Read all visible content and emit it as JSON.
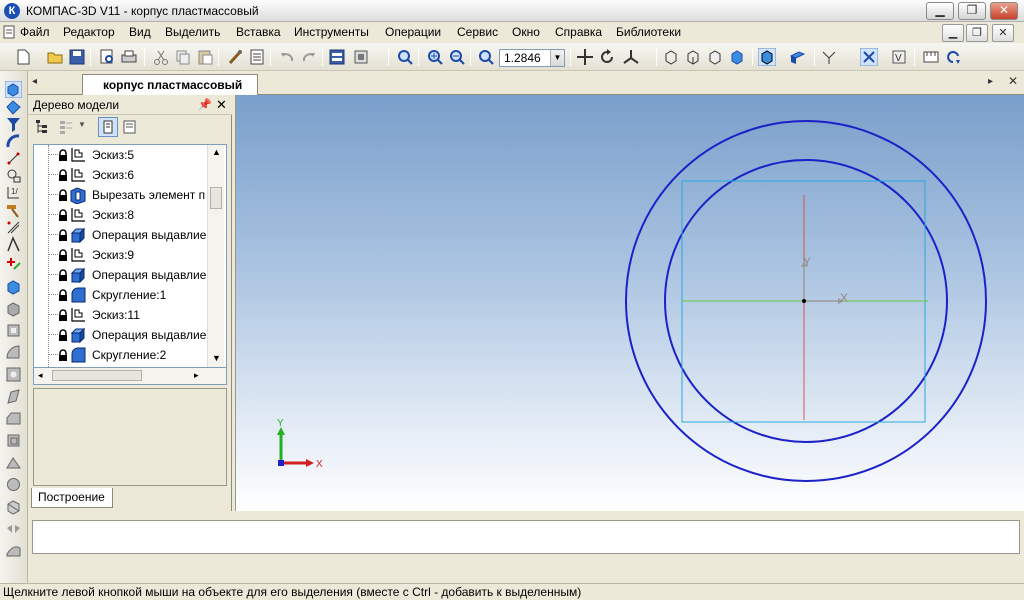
{
  "window": {
    "title": "КОМПАС-3D V11 - корпус пластмассовый",
    "app_icon": "К"
  },
  "menu": {
    "items": [
      "Файл",
      "Редактор",
      "Вид",
      "Выделить",
      "Вставка",
      "Инструменты",
      "Операции",
      "Сервис",
      "Окно",
      "Справка",
      "Библиотеки"
    ]
  },
  "toolbar": {
    "zoom_value": "1.2846"
  },
  "document_tab": {
    "label": "корпус пластмассовый"
  },
  "model_tree": {
    "title": "Дерево модели",
    "items": [
      {
        "label": "Эскиз:5",
        "icon": "sketch-icon"
      },
      {
        "label": "Эскиз:6",
        "icon": "sketch-icon"
      },
      {
        "label": "Вырезать элемент п",
        "icon": "cut-extrude-icon"
      },
      {
        "label": "Эскиз:8",
        "icon": "sketch-icon"
      },
      {
        "label": "Операция выдавлие",
        "icon": "extrude-icon"
      },
      {
        "label": "Эскиз:9",
        "icon": "sketch-icon"
      },
      {
        "label": "Операция выдавлие",
        "icon": "extrude-icon"
      },
      {
        "label": "Скругление:1",
        "icon": "fillet-icon"
      },
      {
        "label": "Эскиз:11",
        "icon": "sketch-icon"
      },
      {
        "label": "Операция выдавлие",
        "icon": "extrude-icon"
      },
      {
        "label": "Скругление:2",
        "icon": "fillet-icon"
      }
    ],
    "bottom_tab": "Построение"
  },
  "viewport": {
    "axis_x": "X",
    "axis_y": "Y",
    "triad_x": "X",
    "triad_y": "Y",
    "curve_color": "#1a22c8",
    "frame_color": "#2aa8e0",
    "x_axis_color": "#66cc33",
    "y_axis_color": "#e05050"
  },
  "status": {
    "text": "Щелкните левой кнопкой мыши на объекте для его выделения (вместе с Ctrl - добавить к выделенным)"
  }
}
